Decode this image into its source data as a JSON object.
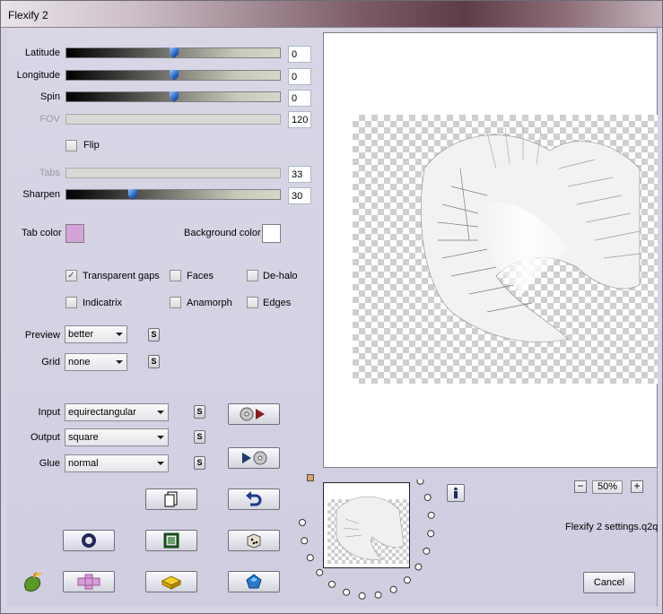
{
  "window": {
    "title": "Flexify 2"
  },
  "sliders": [
    {
      "label": "Latitude",
      "value": "0",
      "level": 0.5,
      "enabled": true
    },
    {
      "label": "Longitude",
      "value": "0",
      "level": 0.5,
      "enabled": true
    },
    {
      "label": "Spin",
      "value": "0",
      "level": 0.5,
      "enabled": true
    },
    {
      "label": "FOV",
      "value": "120",
      "enabled": false
    },
    {
      "label": "Tabs",
      "value": "33",
      "enabled": false
    },
    {
      "label": "Sharpen",
      "value": "30",
      "level": 0.3,
      "enabled": true
    }
  ],
  "flip": {
    "label": "Flip",
    "checked": false
  },
  "colors": {
    "tab_label": "Tab color",
    "tab_value": "#d5a3d8",
    "bg_label": "Background color",
    "bg_value": "#ffffff"
  },
  "options": [
    {
      "label": "Transparent gaps",
      "checked": true
    },
    {
      "label": "Faces",
      "checked": false
    },
    {
      "label": "De-halo",
      "checked": false
    },
    {
      "label": "Indicatrix",
      "checked": false
    },
    {
      "label": "Anamorph",
      "checked": false
    },
    {
      "label": "Edges",
      "checked": false
    }
  ],
  "dropdowns": {
    "preview": {
      "label": "Preview",
      "value": "better"
    },
    "grid": {
      "label": "Grid",
      "value": "none"
    },
    "input": {
      "label": "Input",
      "value": "equirectangular"
    },
    "output": {
      "label": "Output",
      "value": "square"
    },
    "glue": {
      "label": "Glue",
      "value": "normal"
    }
  },
  "s_label": "S",
  "zoom": {
    "minus": "−",
    "value": "50%",
    "plus": "+"
  },
  "settings_file": "Flexify 2 settings.q2q",
  "cancel_label": "Cancel",
  "icons": {
    "info": "info-icon",
    "spin_forward": "disc-to-arrow-icon",
    "spin_back": "arrow-to-disc-icon",
    "copy": "copy-page-icon",
    "undo": "undo-arrow-icon",
    "circle": "ring-icon",
    "frame": "square-frame-icon",
    "dice": "dice-icon",
    "logo": "flaming-pepper-logo-icon",
    "cross": "cross-shape-icon",
    "brick": "yellow-brick-icon",
    "pentagon": "blue-pentagon-icon"
  }
}
